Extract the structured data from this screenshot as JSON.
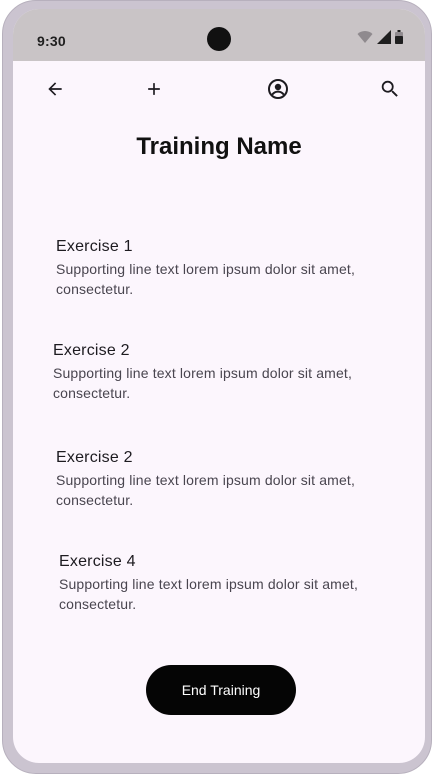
{
  "status_bar": {
    "time": "9:30",
    "icons": [
      "wifi-icon",
      "signal-icon",
      "battery-icon"
    ]
  },
  "top_bar": {
    "icons": [
      "arrow-back-icon",
      "add-icon",
      "account-circle-icon",
      "search-icon"
    ]
  },
  "page": {
    "title": "Training Name"
  },
  "exercises": [
    {
      "title": "Exercise 1",
      "subtitle": "Supporting line text lorem ipsum dolor sit amet, consectetur."
    },
    {
      "title": "Exercise 2",
      "subtitle": "Supporting line text lorem ipsum dolor sit amet, consectetur."
    },
    {
      "title": "Exercise 2",
      "subtitle": "Supporting line text lorem ipsum dolor sit amet, consectetur."
    },
    {
      "title": "Exercise 4",
      "subtitle": "Supporting line text lorem ipsum dolor sit amet, consectetur."
    }
  ],
  "actions": {
    "end_training_label": "End Training"
  },
  "colors": {
    "background": "#fcf6fd",
    "status_bar": "#c9c4c6",
    "device_frame": "#cbc4d0",
    "button": "#050505",
    "button_text": "#ffffff",
    "title_text": "#111111",
    "supporting_text": "#49454f"
  }
}
